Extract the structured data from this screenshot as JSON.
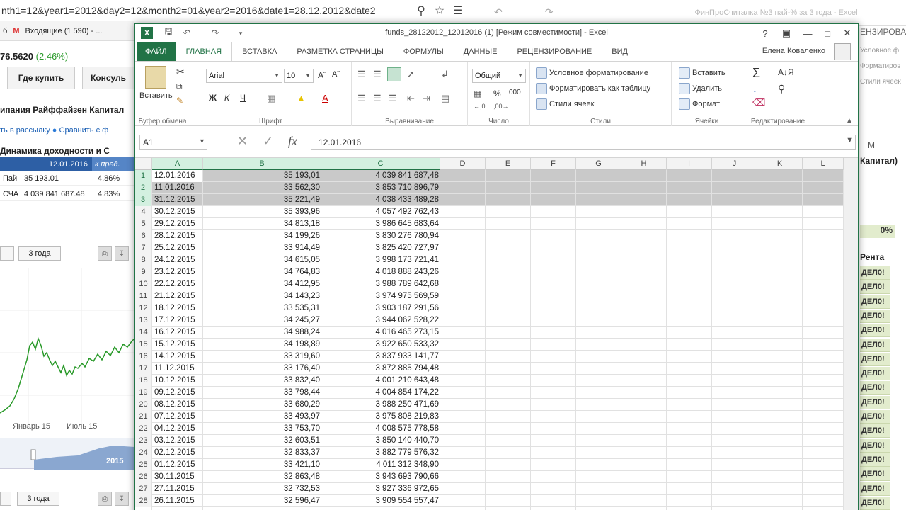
{
  "browser": {
    "url": "nth1=12&year1=2012&day2=12&month2=01&year2=2016&date1=28.12.2012&date2",
    "bookmarks": [
      "б",
      "Входящие (1 590) - ..."
    ]
  },
  "fund_page": {
    "price": "76.5620",
    "change": "(2.46%)",
    "buttons": [
      "Где купить",
      "Консуль"
    ],
    "company": "ипания Райффайзен Капитал",
    "subscribe_link": "ть в рассылку",
    "compare_link": "Сравнить с ф",
    "dynamics_title": "Динамика доходности и С",
    "table_date": "12.01.2016",
    "table_col2": "к пред.",
    "rows": [
      {
        "label": "Пай",
        "value": "35 193.01",
        "pct": "4.86%"
      },
      {
        "label": "СЧА",
        "value": "4 039 841 687.48",
        "pct": "4.83%"
      }
    ],
    "period_3y": "3 года",
    "axis_labels": [
      "Январь 15",
      "Июль 15"
    ],
    "nav_year": "2015"
  },
  "bg_excel": {
    "title": "ФинПроСчиталка №3 пай-% за 3 года - Excel",
    "ribbon_text": "ЕНЗИРОВА",
    "side_labels": [
      "Условное ф",
      "Форматиров",
      "Стили ячеек"
    ],
    "col_m": "M",
    "capital": "Капитал)",
    "zero_pct": "0%",
    "renta": "Рента",
    "cell_text": "ДЕЛ0!"
  },
  "excel": {
    "doc_title": "funds_28122012_12012016 (1)  [Режим совместимости] - Excel",
    "tabs": [
      "ФАЙЛ",
      "ГЛАВНАЯ",
      "ВСТАВКА",
      "РАЗМЕТКА СТРАНИЦЫ",
      "ФОРМУЛЫ",
      "ДАННЫЕ",
      "РЕЦЕНЗИРОВАНИЕ",
      "ВИД"
    ],
    "user": "Елена Коваленко",
    "ribbon": {
      "clipboard_label": "Буфер обмена",
      "paste": "Вставить",
      "font_label": "Шрифт",
      "font_name": "Arial",
      "font_size": "10",
      "alignment_label": "Выравнивание",
      "number_label": "Число",
      "number_format": "Общий",
      "styles_label": "Стили",
      "cond_format": "Условное форматирование",
      "format_table": "Форматировать как таблицу",
      "cell_styles": "Стили ячеек",
      "cells_label": "Ячейки",
      "insert": "Вставить",
      "delete": "Удалить",
      "format": "Формат",
      "editing_label": "Редактирование"
    },
    "name_box": "A1",
    "formula": "12.01.2016",
    "columns": [
      "A",
      "B",
      "C",
      "D",
      "E",
      "F",
      "G",
      "H",
      "I",
      "J",
      "K",
      "L"
    ],
    "rows": [
      [
        "12.01.2016",
        "35 193,01",
        "4 039 841 687,48"
      ],
      [
        "11.01.2016",
        "33 562,30",
        "3 853 710 896,79"
      ],
      [
        "31.12.2015",
        "35 221,49",
        "4 038 433 489,28"
      ],
      [
        "30.12.2015",
        "35 393,96",
        "4 057 492 762,43"
      ],
      [
        "29.12.2015",
        "34 813,18",
        "3 986 645 683,64"
      ],
      [
        "28.12.2015",
        "34 199,26",
        "3 830 276 780,94"
      ],
      [
        "25.12.2015",
        "33 914,49",
        "3 825 420 727,97"
      ],
      [
        "24.12.2015",
        "34 615,05",
        "3 998 173 721,41"
      ],
      [
        "23.12.2015",
        "34 764,83",
        "4 018 888 243,26"
      ],
      [
        "22.12.2015",
        "34 412,95",
        "3 988 789 642,68"
      ],
      [
        "21.12.2015",
        "34 143,23",
        "3 974 975 569,59"
      ],
      [
        "18.12.2015",
        "33 535,31",
        "3 903 187 291,56"
      ],
      [
        "17.12.2015",
        "34 245,27",
        "3 944 062 528,22"
      ],
      [
        "16.12.2015",
        "34 988,24",
        "4 016 465 273,15"
      ],
      [
        "15.12.2015",
        "34 198,89",
        "3 922 650 533,32"
      ],
      [
        "14.12.2015",
        "33 319,60",
        "3 837 933 141,77"
      ],
      [
        "11.12.2015",
        "33 176,40",
        "3 872 885 794,48"
      ],
      [
        "10.12.2015",
        "33 832,40",
        "4 001 210 643,48"
      ],
      [
        "09.12.2015",
        "33 798,44",
        "4 004 854 174,22"
      ],
      [
        "08.12.2015",
        "33 680,29",
        "3 988 250 471,69"
      ],
      [
        "07.12.2015",
        "33 493,97",
        "3 975 808 219,83"
      ],
      [
        "04.12.2015",
        "33 753,70",
        "4 008 575 778,58"
      ],
      [
        "03.12.2015",
        "32 603,51",
        "3 850 140 440,70"
      ],
      [
        "02.12.2015",
        "32 833,37",
        "3 882 779 576,32"
      ],
      [
        "01.12.2015",
        "33 421,10",
        "4 011 312 348,90"
      ],
      [
        "30.11.2015",
        "32 863,48",
        "3 943 693 790,66"
      ],
      [
        "27.11.2015",
        "32 732,53",
        "3 927 336 972,65"
      ],
      [
        "26.11.2015",
        "32 596,47",
        "3 909 554 557,47"
      ]
    ],
    "selected_rows": 3,
    "colors": {
      "accent": "#217346",
      "selection": "#c9c9c9"
    }
  }
}
